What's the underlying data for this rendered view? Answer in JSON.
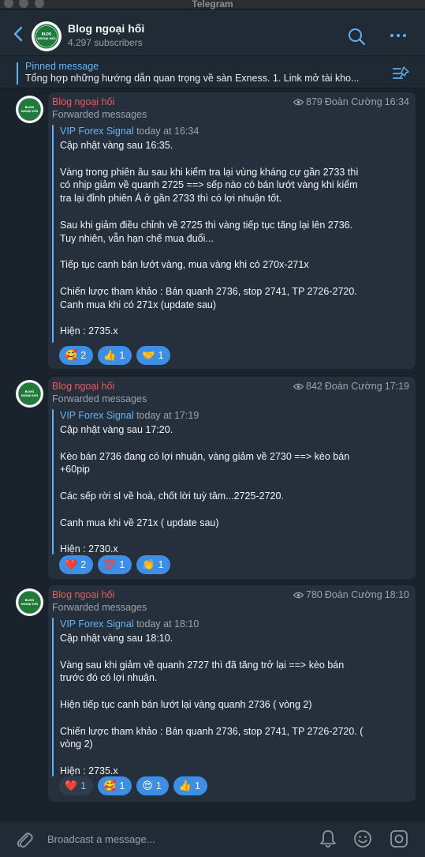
{
  "window": {
    "app_title": "Telegram"
  },
  "header": {
    "channel_name": "Blog ngoại hối",
    "subscribers": "4.297 subscribers",
    "avatar_text": "BLOG NGOẠI HỐI"
  },
  "pinned": {
    "title": "Pinned message",
    "text": "Tổng hợp những hướng dẫn quan trọng về sàn Exness.    1. Link mở tài kho..."
  },
  "messages": [
    {
      "author": "Blog ngoại hối",
      "forwarded_label": "Forwarded messages",
      "views": "879",
      "signature": "Đoàn Cường",
      "time": "16:34",
      "from": "VIP Forex Signal",
      "from_time": "today at 16:34",
      "text": "Cập nhật vàng sau 16:35.\n\nVàng trong phiên âu sau khi kiểm tra lại vùng kháng cự gần 2733 thì có nhịp giảm về quanh 2725 ==> sếp nào có bán lướt vàng khi kiểm tra lại đỉnh phiên Á ở gần 2733 thì có lợi nhuận tốt.\n\nSau khi giảm điều chỉnh về 2725 thì vàng tiếp tục tăng lại lên 2736. Tuy nhiên, vẫn hạn chế mua đuổi...\n\nTiếp tục canh bán lướt vàng, mua vàng khi có 270x-271x\n\nChiến lược tham khảo : Bán quanh 2736, stop 2741, TP 2726-2720. Canh mua khi có 271x (update sau)\n\nHiện : 2735.x",
      "reactions": [
        {
          "emoji": "🥰",
          "count": "2"
        },
        {
          "emoji": "👍",
          "count": "1"
        },
        {
          "emoji": "🤝",
          "count": "1"
        }
      ]
    },
    {
      "author": "Blog ngoại hối",
      "forwarded_label": "Forwarded messages",
      "views": "842",
      "signature": "Đoàn Cường",
      "time": "17:19",
      "from": "VIP Forex Signal",
      "from_time": "today at 17:19",
      "text": "Cập nhật vàng sau 17:20.\n\nKèo bán 2736 đang có lợi nhuận, vàng giảm về 2730 ==> kèo bán +60pip\n\nCác sếp rời sl về hoà, chốt lời tuỳ tâm...2725-2720.\n\nCanh mua khi về 271x ( update sau)\n\nHiện : 2730.x",
      "reactions": [
        {
          "emoji": "❤️",
          "count": "2"
        },
        {
          "emoji": "💯",
          "count": "1"
        },
        {
          "emoji": "👏",
          "count": "1"
        }
      ]
    },
    {
      "author": "Blog ngoại hối",
      "forwarded_label": "Forwarded messages",
      "views": "780",
      "signature": "Đoàn Cường",
      "time": "18:10",
      "from": "VIP Forex Signal",
      "from_time": "today at 18:10",
      "text": "Cập nhật vàng sau 18:10.\n\nVàng sau khi giảm về quanh 2727 thì đã tăng trở lại ==> kèo bán trước đó có lợi nhuận.\n\nHiện tiếp tục canh bán lướt lại vàng quanh 2736 ( vòng 2)\n\nChiến lược tham khảo : Bán quanh 2736, stop 2741, TP 2726-2720. ( vòng 2)\n\nHiện : 2735.x",
      "reactions": [
        {
          "emoji": "❤️",
          "count": "1"
        },
        {
          "emoji": "🥰",
          "count": "1"
        },
        {
          "emoji": "😍",
          "count": "1"
        },
        {
          "emoji": "👍",
          "count": "1"
        }
      ]
    }
  ],
  "composer": {
    "placeholder": "Broadcast a message..."
  },
  "colors": {
    "accent": "#5eaff0",
    "author": "#e45e5e",
    "reaction": "#3c8fe4",
    "bubble": "#25303c",
    "background": "#1a222c"
  },
  "icons": [
    "back-icon",
    "search-icon",
    "more-icon",
    "pin-list-icon",
    "eye-icon",
    "attach-icon",
    "bell-icon",
    "emoji-icon",
    "sticker-icon"
  ]
}
